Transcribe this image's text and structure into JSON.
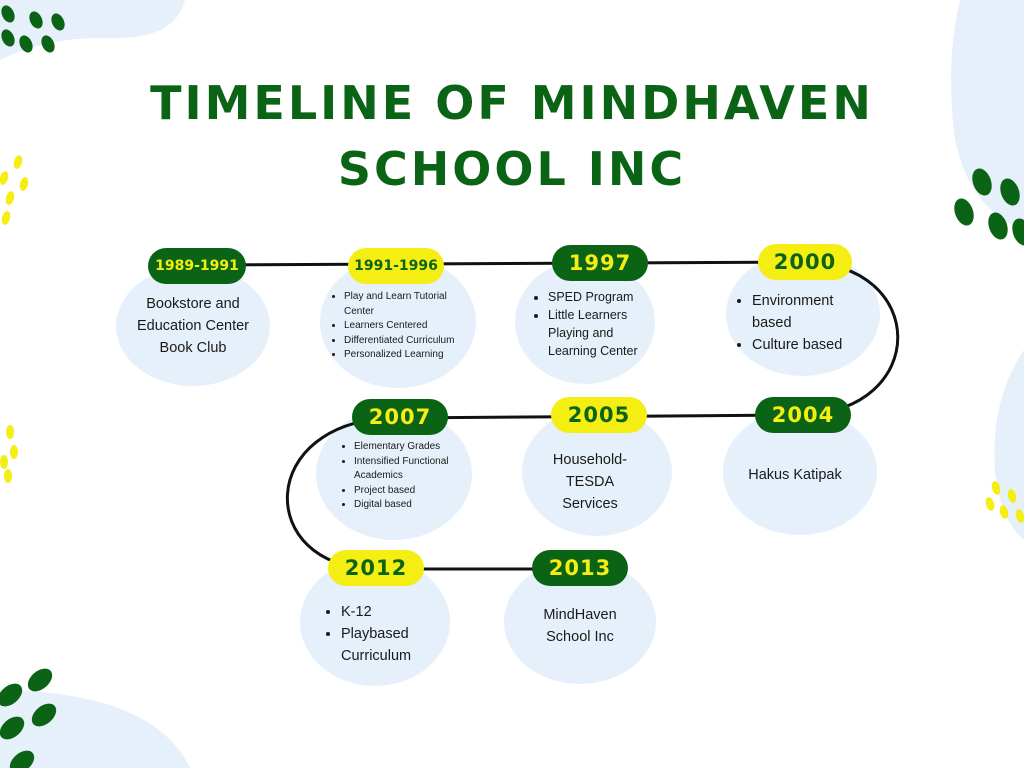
{
  "title_line1": "TIMELINE OF MINDHAVEN",
  "title_line2": "SCHOOL INC",
  "colors": {
    "dark_green": "#0b6416",
    "yellow": "#f4ee12",
    "bubble": "#e6f0fb"
  },
  "events": [
    {
      "year": "1989-1991",
      "lines": [
        "Bookstore and",
        "Education Center",
        "Book Club"
      ]
    },
    {
      "year": "1991-1996",
      "items": [
        "Play and Learn Tutorial Center",
        "Learners Centered",
        "Differentiated Curriculum",
        "Personalized Learning"
      ]
    },
    {
      "year": "1997",
      "items": [
        "SPED Program",
        "Little Learners Playing and Learning Center"
      ]
    },
    {
      "year": "2000",
      "items": [
        "Environment based",
        "Culture based"
      ]
    },
    {
      "year": "2004",
      "lines": [
        "Hakus Katipak"
      ]
    },
    {
      "year": "2005",
      "lines": [
        "Household-",
        "TESDA",
        "Services"
      ]
    },
    {
      "year": "2007",
      "items": [
        "Elementary Grades",
        "Intensified Functional Academics",
        "Project based",
        "Digital based"
      ]
    },
    {
      "year": "2012",
      "items": [
        "K-12",
        "Playbased Curriculum"
      ]
    },
    {
      "year": "2013",
      "lines": [
        "MindHaven",
        "School Inc"
      ]
    }
  ]
}
